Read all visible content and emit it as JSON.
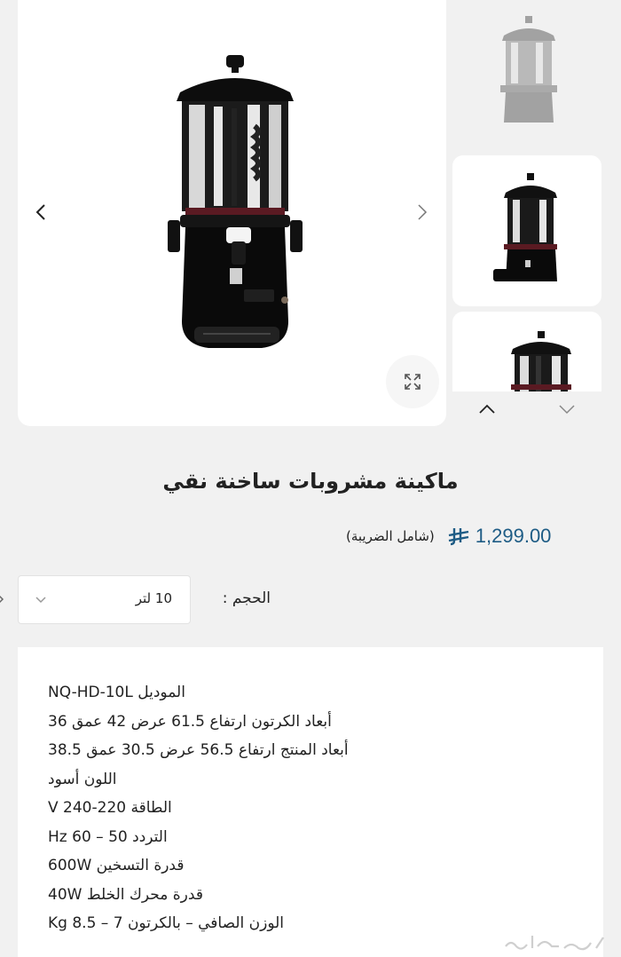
{
  "gallery": {
    "prev_icon": "chevron-left-icon",
    "next_icon": "chevron-right-icon",
    "zoom_icon": "expand-icon",
    "thumb_up_icon": "chevron-up-icon",
    "thumb_down_icon": "chevron-down-icon",
    "thumbnail_count": 3
  },
  "product": {
    "title": "ماكينة مشروبات ساخنة نقي",
    "price": "1,299.00",
    "currency_icon": "saudi-riyal-icon",
    "tax_note": "(شامل الضريبة)",
    "price_color": "#1e5c85"
  },
  "options": {
    "size_label": "الحجم :",
    "size_value": "10 لتر"
  },
  "specs": [
    "الموديل NQ-HD-10L",
    "أبعاد الكرتون ارتفاع 61.5 عرض 42 عمق 36",
    "أبعاد المنتج ارتفاع 56.5 عرض 30.5 عمق 38.5",
    "اللون أسود",
    "الطاقة 220-240 V",
    "التردد 50 – 60 Hz",
    "قدرة التسخين 600W",
    "قدرة محرك الخلط  40W",
    "الوزن الصافي – بالكرتون 7 – 8.5 Kg"
  ],
  "watermark": "حراج"
}
